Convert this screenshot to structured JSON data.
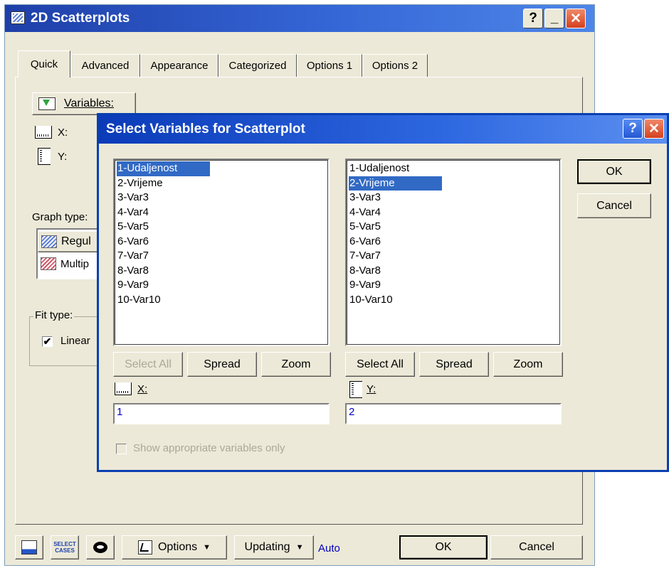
{
  "main_window": {
    "title": "2D Scatterplots",
    "tabs": [
      "Quick",
      "Advanced",
      "Appearance",
      "Categorized",
      "Options 1",
      "Options 2"
    ],
    "variables_label": "Variables:",
    "x_label": "X:",
    "y_label": "Y:",
    "graph_type_label": "Graph type:",
    "graph_types": [
      "Regul",
      "Multip"
    ],
    "fit_type_label": "Fit type:",
    "fit_checkbox_label": "Linear",
    "fit_checkbox_checked": "✔",
    "bottom": {
      "select_icon_text": "SELECT\nCASES",
      "options_label": "Options",
      "updating_label": "Updating",
      "auto_label": "Auto",
      "ok_label": "OK",
      "cancel_label": "Cancel"
    },
    "title_buttons": {
      "help": "?",
      "minimize": "_",
      "close": "✕"
    }
  },
  "dialog": {
    "title": "Select Variables for Scatterplot",
    "title_buttons": {
      "help": "?",
      "close": "✕"
    },
    "left_list": {
      "items": [
        "1-Udaljenost",
        "2-Vrijeme",
        "3-Var3",
        "4-Var4",
        "5-Var5",
        "6-Var6",
        "7-Var7",
        "8-Var8",
        "9-Var9",
        "10-Var10"
      ],
      "selected": "1-Udaljenost"
    },
    "right_list": {
      "items": [
        "1-Udaljenost",
        "2-Vrijeme",
        "3-Var3",
        "4-Var4",
        "5-Var5",
        "6-Var6",
        "7-Var7",
        "8-Var8",
        "9-Var9",
        "10-Var10"
      ],
      "selected": "2-Vrijeme"
    },
    "left_buttons": {
      "select_all": "Select All",
      "spread": "Spread",
      "zoom": "Zoom"
    },
    "right_buttons": {
      "select_all": "Select All",
      "spread": "Spread",
      "zoom": "Zoom"
    },
    "x_label": "X:",
    "y_label": "Y:",
    "x_value": "1",
    "y_value": "2",
    "ok_label": "OK",
    "cancel_label": "Cancel",
    "show_appropriate_label": "Show appropriate variables only"
  },
  "colors": {
    "title_gradient_start": "#1e3fa8",
    "title_gradient_end": "#4e86e8",
    "window_bg": "#ece9d8",
    "selection": "#316ac5",
    "field_text": "#0000c0"
  }
}
